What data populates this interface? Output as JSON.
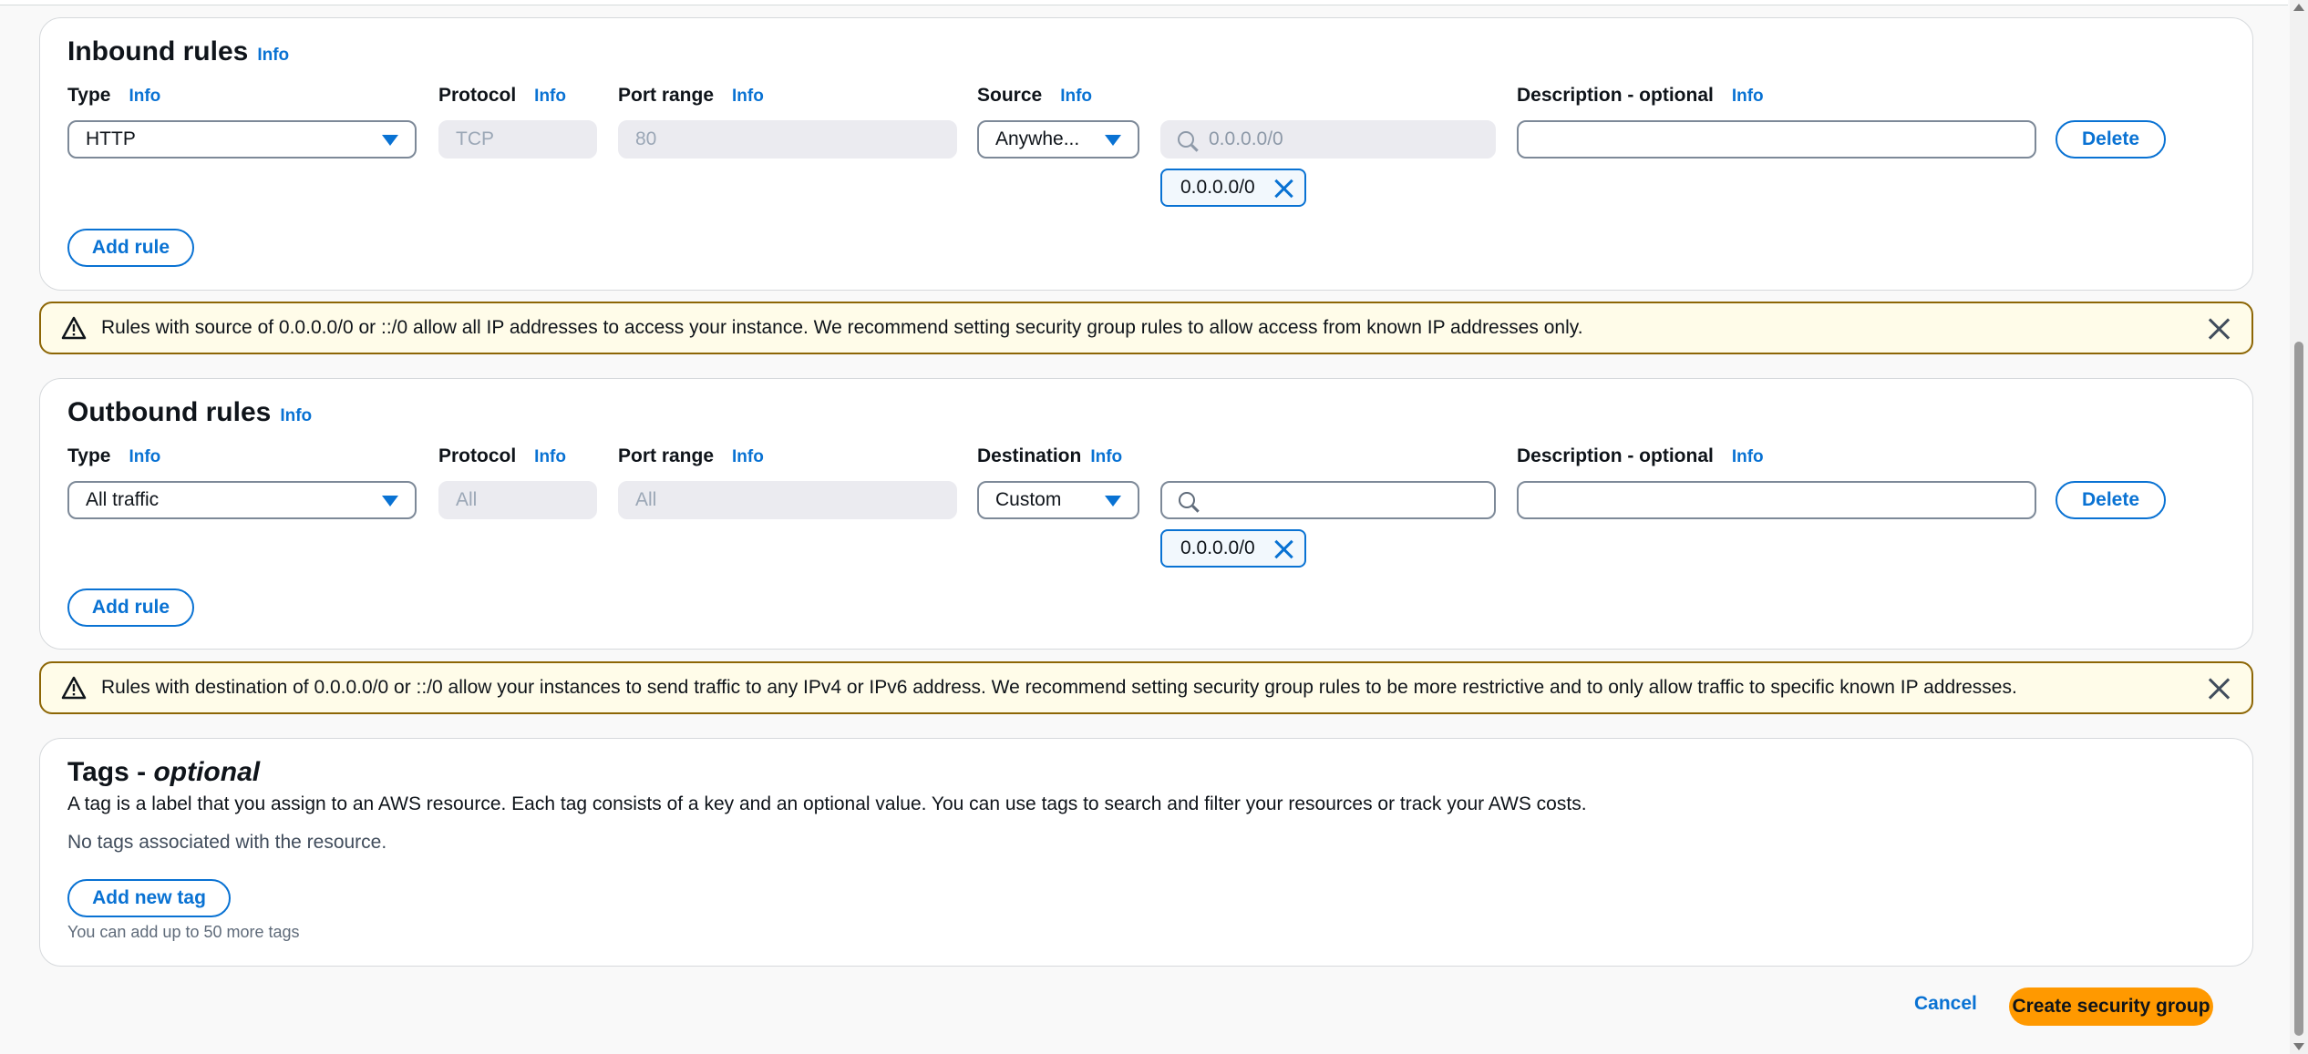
{
  "inbound": {
    "title": "Inbound rules",
    "info": "Info",
    "cols": {
      "type": "Type",
      "protocol": "Protocol",
      "port_range": "Port range",
      "source": "Source",
      "description": "Description - optional"
    },
    "row": {
      "type_value": "HTTP",
      "protocol_value": "TCP",
      "port_value": "80",
      "source_value": "Anywhe...",
      "search_placeholder": "0.0.0.0/0",
      "description_value": "",
      "token": "0.0.0.0/0",
      "delete_label": "Delete"
    },
    "add_rule_label": "Add rule",
    "warning": "Rules with source of 0.0.0.0/0 or ::/0 allow all IP addresses to access your instance. We recommend setting security group rules to allow access from known IP addresses only."
  },
  "outbound": {
    "title": "Outbound rules",
    "info": "Info",
    "cols": {
      "type": "Type",
      "protocol": "Protocol",
      "port_range": "Port range",
      "destination": "Destination",
      "description": "Description - optional"
    },
    "row": {
      "type_value": "All traffic",
      "protocol_value": "All",
      "port_value": "All",
      "destination_value": "Custom",
      "search_value": "",
      "description_value": "",
      "token": "0.0.0.0/0",
      "delete_label": "Delete"
    },
    "add_rule_label": "Add rule",
    "warning": "Rules with destination of 0.0.0.0/0 or ::/0 allow your instances to send traffic to any IPv4 or IPv6 address. We recommend setting security group rules to be more restrictive and to only allow traffic to specific known IP addresses."
  },
  "tags": {
    "title": "Tags - ",
    "title_optional": "optional",
    "description": "A tag is a label that you assign to an AWS resource. Each tag consists of a key and an optional value. You can use tags to search and filter your resources or track your AWS costs.",
    "empty": "No tags associated with the resource.",
    "add_label": "Add new tag",
    "limit": "You can add up to 50 more tags"
  },
  "footer": {
    "cancel": "Cancel",
    "create": "Create security group"
  },
  "colors": {
    "link": "#0972d3",
    "primary": "#ff9900",
    "warning_border": "#8d6605",
    "warning_bg": "#fffce9"
  }
}
